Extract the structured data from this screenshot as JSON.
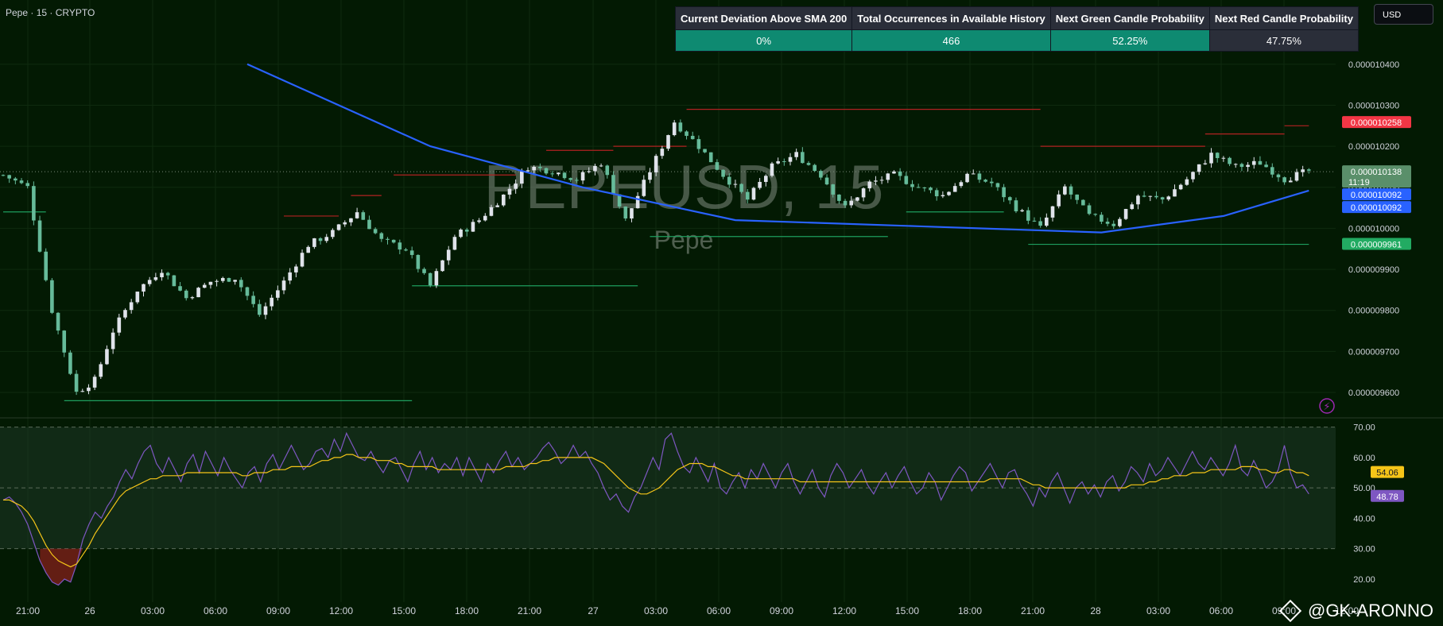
{
  "header": {
    "symbol_label": "Pepe · 15 · CRYPTO"
  },
  "watermark": {
    "symbol": "PEPEUSD, 15",
    "name": "Pepe"
  },
  "currency_selector": "USD",
  "stats_table": {
    "headers": [
      "Current Deviation Above SMA 200",
      "Total Occurrences in Available History",
      "Next Green Candle Probability",
      "Next Red Candle Probability"
    ],
    "values": [
      "0%",
      "466",
      "52.25%",
      "47.75%"
    ],
    "colors": [
      "#0e8a71",
      "#0e8a71",
      "#0e8a71",
      "#2a2e39"
    ]
  },
  "credit": "@GK-ARONNO",
  "colors": {
    "background": "#031a03",
    "sma": "#2962ff",
    "rsi": "#7e57c2",
    "rsi_ma": "#f5c518",
    "up_candle": "#e0e3eb",
    "down_candle": "#66bb9a",
    "resistance": "#b22222",
    "support": "#1e9e5e"
  },
  "chart_data": [
    {
      "type": "candlestick",
      "title": "PEPEUSD, 15",
      "y_axis_ticks": [
        "0.000010400",
        "0.000010300",
        "0.000010200",
        "0.000010100",
        "0.000010000",
        "0.000009900",
        "0.000009800",
        "0.000009700",
        "0.000009600"
      ],
      "x_axis_ticks": [
        "21:00",
        "26",
        "03:00",
        "06:00",
        "09:00",
        "12:00",
        "15:00",
        "18:00",
        "21:00",
        "27",
        "03:00",
        "06:00",
        "09:00",
        "12:00",
        "15:00",
        "18:00",
        "21:00",
        "28",
        "03:00",
        "06:00",
        "09:00",
        "12:00"
      ],
      "ylim": [
        9.54e-06,
        1.045e-05
      ],
      "price_labels": [
        {
          "text": "0.000010258",
          "value": 1.0258e-05,
          "color": "#f23645"
        },
        {
          "text": "0.000010138",
          "value": 1.0138e-05,
          "color": "#5a8f6a",
          "sub": "11:19"
        },
        {
          "text": "0.000010092",
          "value": 1.0092e-05,
          "color": "#2962ff"
        },
        {
          "text": "0.000010092",
          "value": 1.0092e-05,
          "color": "#2962ff"
        },
        {
          "text": "0.000009961",
          "value": 9.961e-06,
          "color": "#22ab62"
        }
      ],
      "price_series_approx": [
        [
          0,
          1.013e-05
        ],
        [
          4,
          1.01e-05
        ],
        [
          8,
          9.8e-06
        ],
        [
          10,
          9.7e-06
        ],
        [
          12,
          9.6e-06
        ],
        [
          15,
          9.63e-06
        ],
        [
          18,
          9.75e-06
        ],
        [
          22,
          9.85e-06
        ],
        [
          26,
          9.9e-06
        ],
        [
          30,
          9.83e-06
        ],
        [
          34,
          9.87e-06
        ],
        [
          38,
          9.88e-06
        ],
        [
          42,
          9.79e-06
        ],
        [
          46,
          9.87e-06
        ],
        [
          50,
          9.96e-06
        ],
        [
          54,
          9.99e-06
        ],
        [
          58,
          1.004e-05
        ],
        [
          62,
          9.97e-06
        ],
        [
          66,
          9.95e-06
        ],
        [
          70,
          9.86e-06
        ],
        [
          74,
          9.98e-06
        ],
        [
          78,
          1.002e-05
        ],
        [
          82,
          1.008e-05
        ],
        [
          86,
          1.015e-05
        ],
        [
          90,
          1.014e-05
        ],
        [
          94,
          1.012e-05
        ],
        [
          98,
          1.016e-05
        ],
        [
          102,
          1.002e-05
        ],
        [
          106,
          1.014e-05
        ],
        [
          110,
          1.026e-05
        ],
        [
          114,
          1.02e-05
        ],
        [
          118,
          1.013e-05
        ],
        [
          122,
          1.007e-05
        ],
        [
          126,
          1.015e-05
        ],
        [
          130,
          1.018e-05
        ],
        [
          134,
          1.013e-05
        ],
        [
          138,
          1.005e-05
        ],
        [
          142,
          1.011e-05
        ],
        [
          146,
          1.013e-05
        ],
        [
          150,
          1.01e-05
        ],
        [
          154,
          1.008e-05
        ],
        [
          158,
          1.013e-05
        ],
        [
          162,
          1.011e-05
        ],
        [
          166,
          1.005e-05
        ],
        [
          170,
          1e-05
        ],
        [
          174,
          1.01e-05
        ],
        [
          178,
          1.003e-05
        ],
        [
          182,
          1.001e-05
        ],
        [
          186,
          1.008e-05
        ],
        [
          190,
          1.007e-05
        ],
        [
          194,
          1.012e-05
        ],
        [
          198,
          1.018e-05
        ],
        [
          202,
          1.015e-05
        ],
        [
          206,
          1.016e-05
        ],
        [
          210,
          1.012e-05
        ],
        [
          214,
          1.014e-05
        ]
      ],
      "sma200_approx": [
        [
          40,
          1.04e-05
        ],
        [
          70,
          1.02e-05
        ],
        [
          95,
          1.01e-05
        ],
        [
          120,
          1.002e-05
        ],
        [
          150,
          1.0005e-05
        ],
        [
          180,
          9.99e-06
        ],
        [
          200,
          1.003e-05
        ],
        [
          214,
          1.0092e-05
        ]
      ],
      "resistance_lines": [
        {
          "y": 1.003e-05,
          "x_start": 46,
          "x_end": 55
        },
        {
          "y": 1.008e-05,
          "x_start": 57,
          "x_end": 62
        },
        {
          "y": 1.013e-05,
          "x_start": 64,
          "x_end": 84
        },
        {
          "y": 1.019e-05,
          "x_start": 89,
          "x_end": 100
        },
        {
          "y": 1.02e-05,
          "x_start": 100,
          "x_end": 112
        },
        {
          "y": 1.029e-05,
          "x_start": 112,
          "x_end": 170
        },
        {
          "y": 1.02e-05,
          "x_start": 170,
          "x_end": 197
        },
        {
          "y": 1.023e-05,
          "x_start": 197,
          "x_end": 210
        },
        {
          "y": 1.025e-05,
          "x_start": 210,
          "x_end": 214
        }
      ],
      "support_lines": [
        {
          "y": 1.004e-05,
          "x_start": 0,
          "x_end": 7
        },
        {
          "y": 9.58e-06,
          "x_start": 10,
          "x_end": 67
        },
        {
          "y": 9.86e-06,
          "x_start": 67,
          "x_end": 104
        },
        {
          "y": 1.004e-05,
          "x_start": 148,
          "x_end": 164
        },
        {
          "y": 9.98e-06,
          "x_start": 106,
          "x_end": 145
        },
        {
          "y": 9.961e-06,
          "x_start": 168,
          "x_end": 214
        }
      ]
    },
    {
      "type": "line",
      "title": "RSI",
      "y_axis_ticks": [
        "70.00",
        "60.00",
        "50.00",
        "40.00",
        "30.00",
        "20.00"
      ],
      "ylim": [
        15,
        72
      ],
      "bands": [
        70,
        50,
        30
      ],
      "current_values": [
        {
          "text": "54.06",
          "value": 54.06,
          "color": "#f5c518"
        },
        {
          "text": "48.78",
          "value": 48.78,
          "color": "#7e57c2"
        }
      ],
      "series": [
        {
          "values": [
            46,
            47,
            45,
            42,
            38,
            32,
            26,
            22,
            19,
            18,
            20,
            19,
            25,
            33,
            38,
            42,
            40,
            44,
            47,
            52,
            56,
            53,
            58,
            62,
            64,
            58,
            55,
            60,
            56,
            52,
            58,
            61,
            55,
            62,
            58,
            54,
            60,
            56,
            53,
            50,
            55,
            57,
            52,
            58,
            61,
            56,
            60,
            64,
            60,
            56,
            58,
            62,
            63,
            60,
            66,
            62,
            68,
            64,
            60,
            59,
            62,
            58,
            55,
            59,
            60,
            56,
            52,
            58,
            62,
            56,
            60,
            55,
            58,
            56,
            60,
            54,
            60,
            56,
            52,
            58,
            55,
            59,
            62,
            57,
            60,
            56,
            58,
            60,
            63,
            65,
            62,
            58,
            60,
            64,
            60,
            62,
            58,
            55,
            50,
            46,
            48,
            44,
            42,
            47,
            50,
            55,
            60,
            56,
            66,
            68,
            62,
            57,
            55,
            60,
            56,
            52,
            58,
            50,
            48,
            52,
            55,
            50,
            56,
            53,
            58,
            54,
            50,
            55,
            58,
            52,
            48,
            52,
            56,
            50,
            47,
            54,
            58,
            55,
            50,
            53,
            56,
            51,
            48,
            52,
            55,
            50,
            54,
            57,
            52,
            48,
            50,
            55,
            52,
            46,
            50,
            54,
            57,
            55,
            49,
            52,
            55,
            58,
            54,
            50,
            55,
            56,
            51,
            48,
            44,
            50,
            47,
            52,
            55,
            50,
            45,
            50,
            52,
            48,
            51,
            47,
            52,
            54,
            49,
            52,
            57,
            55,
            52,
            58,
            54,
            56,
            60,
            57,
            54,
            58,
            62,
            58,
            56,
            60,
            57,
            54,
            58,
            64,
            56,
            54,
            59,
            55,
            50,
            52,
            56,
            64,
            55,
            50,
            51,
            48
          ]
        },
        {
          "values": [
            46,
            46,
            45,
            44,
            42,
            39,
            35,
            31,
            28,
            26,
            25,
            24,
            25,
            28,
            31,
            35,
            38,
            41,
            44,
            47,
            49,
            50,
            51,
            52,
            53,
            53,
            54,
            54,
            54,
            54,
            55,
            55,
            55,
            55,
            55,
            55,
            55,
            55,
            55,
            54,
            54,
            55,
            55,
            55,
            56,
            56,
            56,
            57,
            57,
            57,
            57,
            58,
            59,
            59,
            60,
            60,
            61,
            61,
            60,
            60,
            60,
            59,
            59,
            59,
            58,
            58,
            57,
            57,
            57,
            57,
            57,
            56,
            56,
            56,
            56,
            56,
            56,
            56,
            56,
            56,
            56,
            56,
            57,
            57,
            57,
            57,
            58,
            58,
            59,
            59,
            60,
            60,
            60,
            60,
            60,
            60,
            60,
            59,
            58,
            56,
            54,
            52,
            50,
            49,
            48,
            48,
            49,
            50,
            52,
            54,
            56,
            57,
            58,
            58,
            58,
            57,
            57,
            56,
            55,
            54,
            54,
            53,
            53,
            53,
            53,
            53,
            53,
            53,
            53,
            53,
            52,
            52,
            52,
            52,
            52,
            52,
            52,
            52,
            52,
            52,
            52,
            52,
            52,
            52,
            52,
            52,
            52,
            52,
            52,
            52,
            52,
            52,
            52,
            52,
            52,
            52,
            52,
            52,
            52,
            52,
            52,
            53,
            53,
            53,
            53,
            53,
            53,
            52,
            51,
            51,
            50,
            50,
            50,
            50,
            50,
            50,
            50,
            50,
            50,
            50,
            50,
            50,
            50,
            50,
            51,
            51,
            51,
            52,
            52,
            53,
            53,
            54,
            54,
            54,
            55,
            55,
            55,
            56,
            56,
            56,
            56,
            56,
            57,
            57,
            57,
            56,
            56,
            55,
            55,
            56,
            56,
            55,
            55,
            54
          ]
        }
      ]
    }
  ]
}
